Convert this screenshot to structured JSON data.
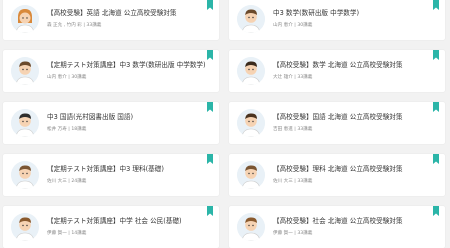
{
  "colors": {
    "bookmark": "#2bb5a8",
    "background": "#f2f2f2",
    "card": "#ffffff"
  },
  "courses": [
    {
      "title": "【高校受験】英語 北海道 公立高校受験対策",
      "teacher": "森 正允 , 竹内 彩",
      "lessons": "33講義",
      "avatar": "teacher-woman-avatar-icon"
    },
    {
      "title": "中3 数学(数研出版 中学数学)",
      "teacher": "山内 恵介",
      "lessons": "30講義",
      "avatar": "teacher-man-avatar-icon"
    },
    {
      "title": "【定期テスト対策講座】中3 数学(数研出版 中学数学)",
      "teacher": "山内 恵介",
      "lessons": "30講義",
      "avatar": "teacher-man-avatar-icon"
    },
    {
      "title": "【高校受験】数学 北海道 公立高校受験対策",
      "teacher": "大辻 雄介",
      "lessons": "33講義",
      "avatar": "teacher-man-avatar-icon"
    },
    {
      "title": "中3 国語(光村図書出版 国語)",
      "teacher": "松井 万寿",
      "lessons": "18講義",
      "avatar": "teacher-man-avatar-icon"
    },
    {
      "title": "【高校受験】国語 北海道 公立高校受験対策",
      "teacher": "吉田 恵進",
      "lessons": "33講義",
      "avatar": "teacher-man-avatar-icon"
    },
    {
      "title": "【定期テスト対策講座】中3 理科(基礎)",
      "teacher": "佐川 大三",
      "lessons": "24講義",
      "avatar": "teacher-man-avatar-icon"
    },
    {
      "title": "【高校受験】理科 北海道 公立高校受験対策",
      "teacher": "佐川 大三",
      "lessons": "33講義",
      "avatar": "teacher-man-avatar-icon"
    },
    {
      "title": "【定期テスト対策講座】中学 社会 公民(基礎)",
      "teacher": "伊藤 賀一",
      "lessons": "14講義",
      "avatar": "teacher-man-avatar-icon"
    },
    {
      "title": "【高校受験】社会 北海道 公立高校受験対策",
      "teacher": "伊藤 賀一",
      "lessons": "33講義",
      "avatar": "teacher-man-avatar-icon"
    }
  ]
}
